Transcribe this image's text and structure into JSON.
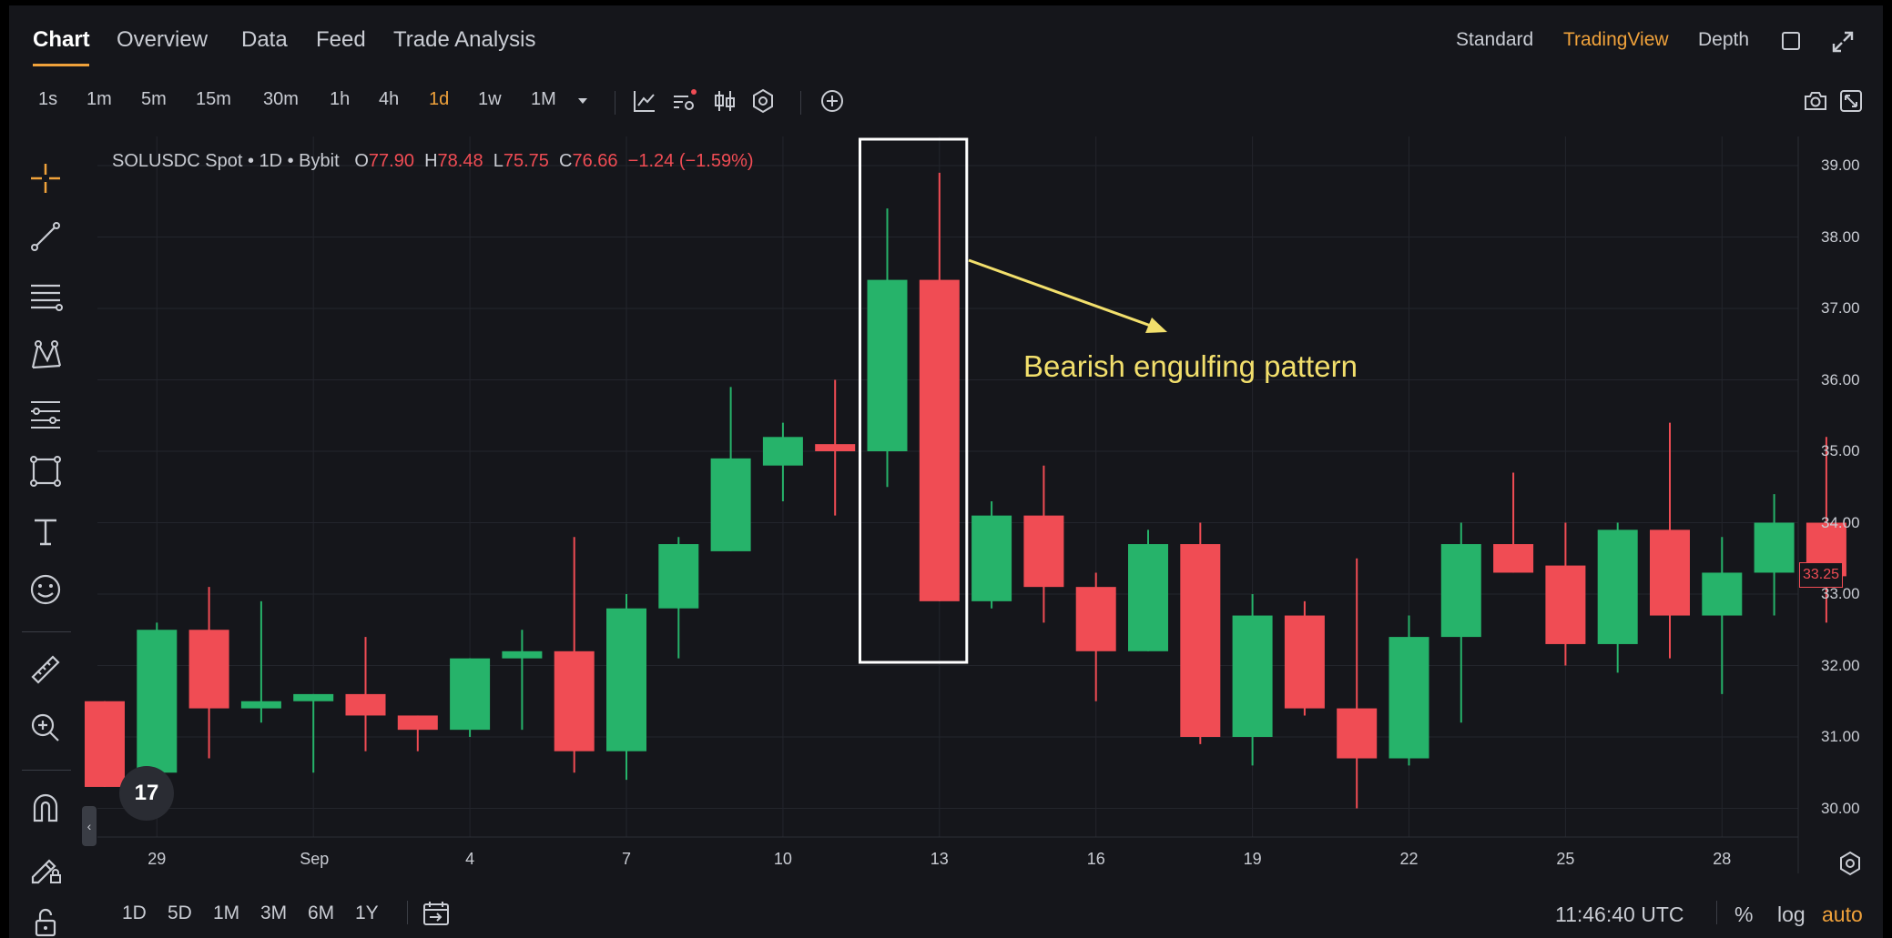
{
  "tabs": [
    {
      "label": "Chart",
      "active": true
    },
    {
      "label": "Overview",
      "active": false
    },
    {
      "label": "Data",
      "active": false
    },
    {
      "label": "Feed",
      "active": false
    },
    {
      "label": "Trade Analysis",
      "active": false
    }
  ],
  "view_modes": [
    {
      "label": "Standard",
      "active": false
    },
    {
      "label": "TradingView",
      "active": true
    },
    {
      "label": "Depth",
      "active": false
    }
  ],
  "intervals": [
    {
      "label": "1s",
      "active": false
    },
    {
      "label": "1m",
      "active": false
    },
    {
      "label": "5m",
      "active": false
    },
    {
      "label": "15m",
      "active": false
    },
    {
      "label": "30m",
      "active": false
    },
    {
      "label": "1h",
      "active": false
    },
    {
      "label": "4h",
      "active": false
    },
    {
      "label": "1d",
      "active": true
    },
    {
      "label": "1w",
      "active": false
    },
    {
      "label": "1M",
      "active": false
    }
  ],
  "toolbar_icons": [
    "indicator-icon",
    "chart-type-icon",
    "candles-icon",
    "settings-hex-icon",
    "add-icon",
    "camera-icon",
    "fullscreen-icon"
  ],
  "left_tools": [
    "crosshair-icon",
    "trend-line-icon",
    "horizontal-lines-icon",
    "pattern-icon",
    "fib-icon",
    "rectangle-icon",
    "text-icon",
    "emoji-icon",
    "ruler-icon",
    "zoom-in-icon",
    "magnet-icon",
    "lock-draw-icon",
    "lock-icon"
  ],
  "legend": {
    "symbol": "SOLUSDC Spot • 1D • Bybit",
    "o_label": "O",
    "o": "77.90",
    "h_label": "H",
    "h": "78.48",
    "l_label": "L",
    "l": "75.75",
    "c_label": "C",
    "c": "76.66",
    "change": "−1.24 (−1.59%)"
  },
  "annotation": {
    "text": "Bearish engulfing pattern",
    "color": "#f2df6c",
    "box_color": "#ffffff"
  },
  "logo_text": "17",
  "bottom": {
    "ranges": [
      "1D",
      "5D",
      "1M",
      "3M",
      "6M",
      "1Y"
    ],
    "clock": "11:46:40 UTC",
    "percent": "%",
    "log": "log",
    "auto": "auto"
  },
  "colors": {
    "up": "#26b36a",
    "down": "#f04c54",
    "accent": "#f0a23b",
    "bg": "#15161b",
    "grid": "#23252c"
  },
  "chart_data": {
    "type": "candlestick",
    "title": "SOLUSDC Spot • 1D • Bybit",
    "ylim": [
      29.5,
      39.2
    ],
    "y_ticks": [
      "39.00",
      "38.00",
      "37.00",
      "36.00",
      "35.00",
      "34.00",
      "33.00",
      "32.00",
      "31.00",
      "30.00"
    ],
    "x_tick_labels": [
      "29",
      "Sep",
      "4",
      "7",
      "10",
      "13",
      "16",
      "19",
      "22",
      "25",
      "28"
    ],
    "last_price": "33.25",
    "candles": [
      {
        "o": 31.5,
        "h": 31.5,
        "l": 30.3,
        "c": 30.3
      },
      {
        "o": 30.5,
        "h": 32.6,
        "l": 30.5,
        "c": 32.5
      },
      {
        "o": 32.5,
        "h": 33.1,
        "l": 30.7,
        "c": 31.4
      },
      {
        "o": 31.4,
        "h": 32.9,
        "l": 31.2,
        "c": 31.5
      },
      {
        "o": 31.5,
        "h": 31.6,
        "l": 30.5,
        "c": 31.6
      },
      {
        "o": 31.6,
        "h": 32.4,
        "l": 30.8,
        "c": 31.3
      },
      {
        "o": 31.3,
        "h": 31.3,
        "l": 30.8,
        "c": 31.1
      },
      {
        "o": 31.1,
        "h": 32.1,
        "l": 31.0,
        "c": 32.1
      },
      {
        "o": 32.1,
        "h": 32.5,
        "l": 31.1,
        "c": 32.2
      },
      {
        "o": 32.2,
        "h": 33.8,
        "l": 30.5,
        "c": 30.8
      },
      {
        "o": 30.8,
        "h": 33.0,
        "l": 30.4,
        "c": 32.8
      },
      {
        "o": 32.8,
        "h": 33.8,
        "l": 32.1,
        "c": 33.7
      },
      {
        "o": 33.6,
        "h": 35.9,
        "l": 33.6,
        "c": 34.9
      },
      {
        "o": 34.8,
        "h": 35.4,
        "l": 34.3,
        "c": 35.2
      },
      {
        "o": 35.1,
        "h": 36.0,
        "l": 34.1,
        "c": 35.0
      },
      {
        "o": 35.0,
        "h": 38.4,
        "l": 34.5,
        "c": 37.4
      },
      {
        "o": 37.4,
        "h": 38.9,
        "l": 32.9,
        "c": 32.9
      },
      {
        "o": 32.9,
        "h": 34.3,
        "l": 32.8,
        "c": 34.1
      },
      {
        "o": 34.1,
        "h": 34.8,
        "l": 32.6,
        "c": 33.1
      },
      {
        "o": 33.1,
        "h": 33.3,
        "l": 31.5,
        "c": 32.2
      },
      {
        "o": 32.2,
        "h": 33.9,
        "l": 32.2,
        "c": 33.7
      },
      {
        "o": 33.7,
        "h": 34.0,
        "l": 30.9,
        "c": 31.0
      },
      {
        "o": 31.0,
        "h": 33.0,
        "l": 30.6,
        "c": 32.7
      },
      {
        "o": 32.7,
        "h": 32.9,
        "l": 31.3,
        "c": 31.4
      },
      {
        "o": 31.4,
        "h": 33.5,
        "l": 30.0,
        "c": 30.7
      },
      {
        "o": 30.7,
        "h": 32.7,
        "l": 30.6,
        "c": 32.4
      },
      {
        "o": 32.4,
        "h": 34.0,
        "l": 31.2,
        "c": 33.7
      },
      {
        "o": 33.7,
        "h": 34.7,
        "l": 33.3,
        "c": 33.3
      },
      {
        "o": 33.4,
        "h": 34.0,
        "l": 32.0,
        "c": 32.3
      },
      {
        "o": 32.3,
        "h": 34.0,
        "l": 31.9,
        "c": 33.9
      },
      {
        "o": 33.9,
        "h": 35.4,
        "l": 32.1,
        "c": 32.7
      },
      {
        "o": 32.7,
        "h": 33.8,
        "l": 31.6,
        "c": 33.3
      },
      {
        "o": 33.3,
        "h": 34.4,
        "l": 32.7,
        "c": 34.0
      },
      {
        "o": 34.0,
        "h": 35.2,
        "l": 32.6,
        "c": 33.25
      }
    ]
  }
}
